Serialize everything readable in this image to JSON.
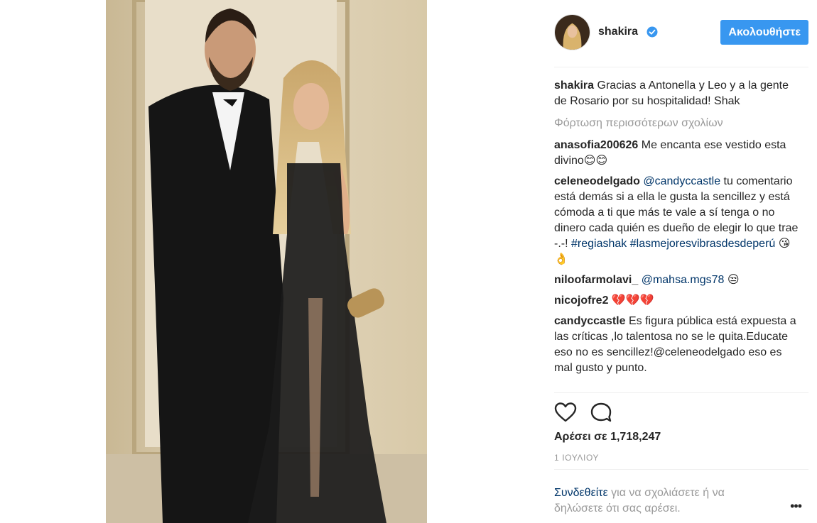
{
  "post": {
    "username": "shakira",
    "follow_label": "Ακολουθήστε",
    "caption_user": "shakira",
    "caption_text": "Gracias a Antonella y Leo y a la gente de Rosario por su hospitalidad! Shak",
    "load_more": "Φόρτωση περισσότερων σχολίων",
    "likes_text": "Αρέσει σε 1,718,247",
    "date": "1 ΙΟΥΛΙΟΥ",
    "login_link": "Συνδεθείτε",
    "login_rest": " για να σχολιάσετε ή να δηλώσετε ότι σας αρέσει.",
    "more_glyph": "•••"
  },
  "comments": {
    "c1": {
      "user": "anasofia200626",
      "text": " Me encanta ese vestido esta divino😊😊"
    },
    "c2": {
      "user": "celeneodelgado",
      "mention": "@candyccastle",
      "text": " tu comentario está demás si a ella le gusta la sencillez y está cómoda a ti que más te vale a sí tenga o no dinero cada quién es dueño de elegir lo que trae -.-! ",
      "tag1": "#regiashak",
      "tag2": "#lasmejoresvibrasdesdeperú",
      "emoji": " 😘👌"
    },
    "c3": {
      "user": "niloofarmolavi_",
      "mention": "@mahsa.mgs78",
      "emoji": " 😒"
    },
    "c4": {
      "user": "nicojofre2",
      "emoji": " 💔💔💔"
    },
    "c5": {
      "user": "candyccastle",
      "text": " Es figura pública está expuesta a las críticas ,lo talentosa no se le quita.Educate eso no es sencillez!@celeneodelgado eso es mal gusto y punto."
    }
  },
  "icons": {
    "verified": "verified-badge-icon",
    "like": "heart-icon",
    "comment": "comment-bubble-icon",
    "more": "more-options-icon"
  },
  "colors": {
    "follow_button": "#3897f0",
    "link": "#003569",
    "muted": "#999999",
    "text": "#262626"
  }
}
